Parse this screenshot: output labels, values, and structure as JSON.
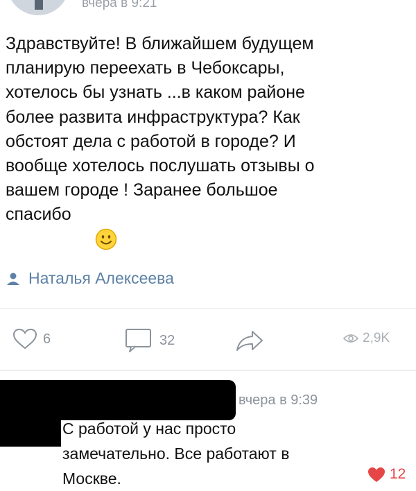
{
  "post": {
    "time": "вчера в 9:21",
    "text": "Здравствуйте! В ближайшем будущем\nпланирую переехать в Чебоксары,\nхотелось бы узнать ...в каком районе\nболее развита инфраструктура? Как\nобстоят дела с работой в городе? И\nвообще хотелось послушать отзывы о\nвашем городе ! Заранее большое\nспасибо",
    "emoji": "smile-emoji",
    "author": "Наталья Алексеева"
  },
  "actions": {
    "likes": "6",
    "comments": "32",
    "views": "2,9K"
  },
  "reply": {
    "time": "вчера в 9:39",
    "text": "С работой у нас просто\nзамечательно. Все работают в\nМоскве.",
    "likes": "12"
  },
  "colors": {
    "link": "#5d81a6",
    "muted": "#8c939b",
    "like_red": "#e64646"
  }
}
